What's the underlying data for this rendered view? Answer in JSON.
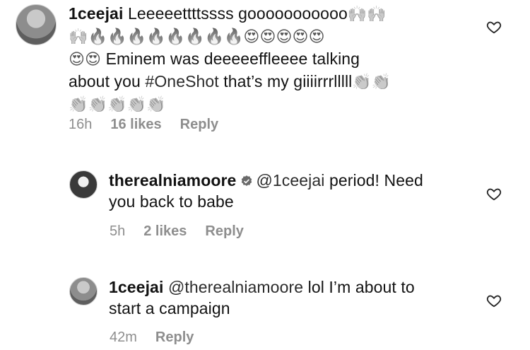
{
  "comments": [
    {
      "username": "1ceejai",
      "text_line1": "Leeeeettttssss gooooooooooo",
      "emoji_line1": "🙌🙌",
      "emoji_line2": "🙌🔥🔥🔥🔥🔥🔥🔥🔥😍😍😍😍😍",
      "emoji_line3": "😍😍",
      "text_line3": " Eminem was deeeeeffleeee talking",
      "text_line4a": "about you ",
      "hashtag": "#OneShot",
      "text_line4b": " that’s my giiiirrrlllll",
      "emoji_line4": "👏👏",
      "emoji_line5": "👏👏👏👏👏",
      "time": "16h",
      "likes": "16 likes",
      "reply": "Reply"
    },
    {
      "username": "therealniamoore",
      "mention": "@1ceejai",
      "text_line1": " period! Need",
      "text_line2": "you back to babe",
      "time": "5h",
      "likes": "2 likes",
      "reply": "Reply"
    },
    {
      "username": "1ceejai",
      "mention": "@therealniamoore",
      "text_line1": " lol I’m about to",
      "text_line2": "start a campaign",
      "time": "42m",
      "reply": "Reply"
    }
  ],
  "icons": {
    "like": "heart-outline-icon",
    "verified": "verified-badge-icon"
  }
}
